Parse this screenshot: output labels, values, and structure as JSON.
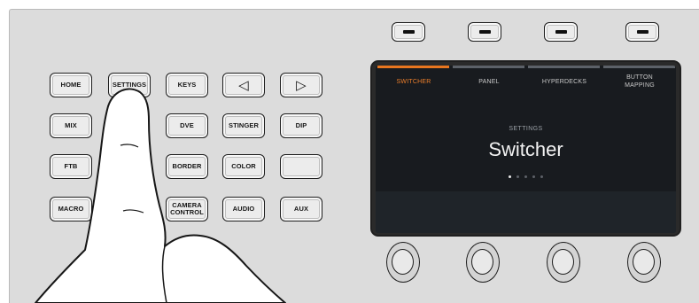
{
  "keypad": {
    "home": "HOME",
    "settings": "SETTINGS",
    "keys": "KEYS",
    "left_arrow": "◁",
    "right_arrow": "▷",
    "mix": "MIX",
    "dve": "DVE",
    "stinger": "STINGER",
    "dip": "DIP",
    "ftb": "FTB",
    "border": "BORDER",
    "color": "COLOR",
    "blank": "",
    "macro": "MACRO",
    "camera_control_line1": "CAMERA",
    "camera_control_line2": "CONTROL",
    "audio": "AUDIO",
    "aux": "AUX"
  },
  "lcd": {
    "tabs": [
      {
        "label": "SWITCHER",
        "active": true
      },
      {
        "label": "PANEL",
        "active": false
      },
      {
        "label": "HYPERDECKS",
        "active": false
      },
      {
        "label": "BUTTON MAPPING",
        "line1": "BUTTON",
        "line2": "MAPPING",
        "active": false
      }
    ],
    "section_label": "SETTINGS",
    "page_title": "Switcher",
    "page_count": 5,
    "current_page": 1,
    "accent_color": "#e8761f"
  },
  "soft_buttons": 4,
  "knobs": 4
}
